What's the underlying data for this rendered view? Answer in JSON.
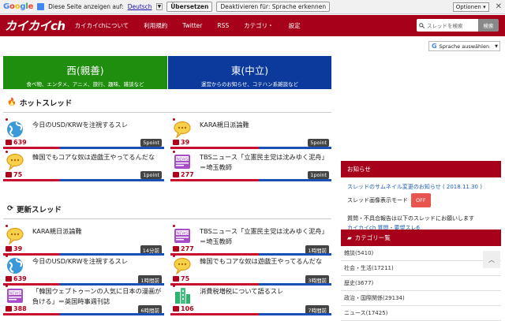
{
  "translate_bar": {
    "prefix": "Diese Seite anzeigen auf:",
    "language": "Deutsch",
    "translate_button": "Übersetzen",
    "deactivate_button": "Deaktivieren für: Sprache erkennen",
    "options_button": "Optionen"
  },
  "nav": {
    "logo": "カイカイch",
    "items": [
      "カイカイchについて",
      "利用規約",
      "Twitter",
      "RSS",
      "カテゴリ・",
      "設定"
    ],
    "search_placeholder": "スレッドを検索",
    "search_button": "検索"
  },
  "google_select": "Sprache auswählen",
  "categories": [
    {
      "title": "西(親善)",
      "subtitle": "食べ物、エンタメ、アニメ、旅行、趣味、雑談など",
      "color": "#1f8d0e"
    },
    {
      "title": "東(中立)",
      "subtitle": "運営からのお知らせ、コテハン系雑談など",
      "color": "#0b3a9c"
    }
  ],
  "hot_title": "ホットスレッド",
  "new_title": "更新スレッド",
  "hot_threads": [
    {
      "title": "今日のUSD/KRWを注視するスレ",
      "comments": "639",
      "badge": "5point",
      "avatar": "globe"
    },
    {
      "title": "KARA親日派論難",
      "comments": "39",
      "badge": "5point",
      "avatar": "speech"
    },
    {
      "title": "韓国でもコアな奴は遊戯王やってるんだな",
      "comments": "75",
      "badge": "1point",
      "avatar": "speech"
    },
    {
      "title": "TBSニュース「立憲民主党は沈みゆく泥舟」＝埼玉教師",
      "comments": "277",
      "badge": "1point",
      "avatar": "news"
    }
  ],
  "new_threads": [
    {
      "title": "KARA親日派論難",
      "comments": "39",
      "badge": "14分前",
      "avatar": "speech"
    },
    {
      "title": "TBSニュース「立憲民主党は沈みゆく泥舟」＝埼玉教師",
      "comments": "277",
      "badge": "1時間前",
      "avatar": "news"
    },
    {
      "title": "今日のUSD/KRWを注視するスレ",
      "comments": "639",
      "badge": "1時間前",
      "avatar": "globe"
    },
    {
      "title": "韓国でもコアな奴は遊戯王やってるんだな",
      "comments": "75",
      "badge": "3時間前",
      "avatar": "speech"
    },
    {
      "title": "「韓国ウェブトゥーンの人気に日本の漫画が負ける」＝英国時事週刊誌",
      "comments": "388",
      "badge": "6時間前",
      "avatar": "news"
    },
    {
      "title": "消費税増税について語るスレ",
      "comments": "106",
      "badge": "7時間前",
      "avatar": "building"
    }
  ],
  "notice": {
    "header": "お知らせ",
    "link": "スレッドのサムネイル変更のお知らせ ( 2018.11.30 )",
    "mode_label": "スレッド画像表示モード",
    "mode_button": "OFF",
    "contact_text": "質問・不具合報告は以下のスレッドにお願いします",
    "contact_link": "カイカイch 質問・要望スレ6"
  },
  "category_list": {
    "header": "カテゴリー覧",
    "items": [
      "雑談(5410)",
      "社会・生活(17211)",
      "歴史(3677)",
      "政治・国際関係(29134)",
      "ニュース(17425)"
    ]
  }
}
